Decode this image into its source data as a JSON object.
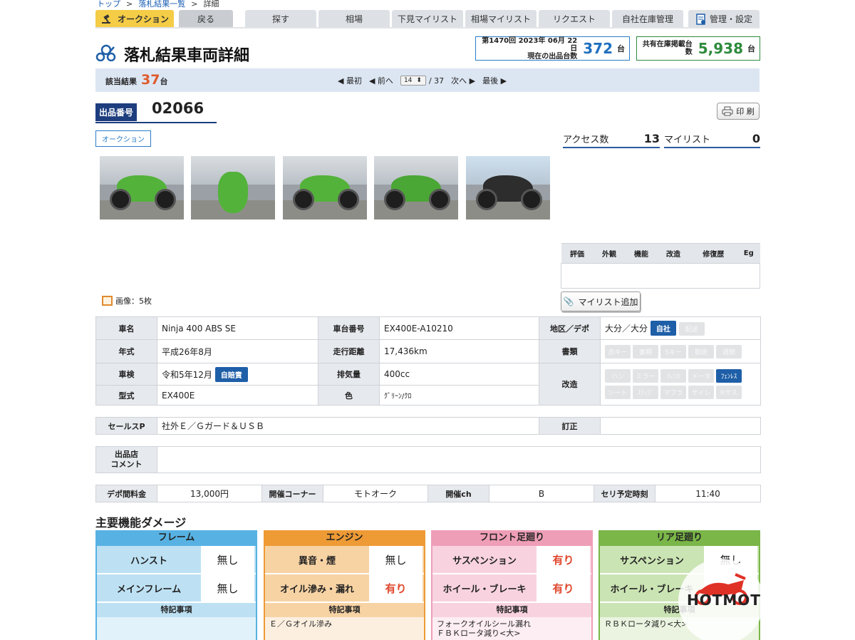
{
  "breadcrumb": [
    "トップ",
    "落札結果一覧",
    "詳細"
  ],
  "breadcrumb_sep": ">",
  "nav": {
    "auction": "オークション",
    "back": "戻る",
    "tabs": [
      "探す",
      "相場",
      "下見マイリスト",
      "相場マイリスト",
      "リクエスト",
      "自社在庫管理"
    ],
    "settings": "管理・設定"
  },
  "page": {
    "title": "落札結果車両詳細",
    "session_line1": "第1470回 2023年 06月 22日",
    "session_line2": "現在の出品台数",
    "listing_count": "372",
    "unit": "台",
    "shared_label": "共有在庫掲載台数",
    "shared_count": "5,938"
  },
  "results": {
    "label": "該当結果",
    "count": "37",
    "unit": "台",
    "first": "◀ 最初",
    "prev": "◀ 前へ",
    "page": "14",
    "total": "/ 37",
    "next": "次へ ▶",
    "last": "最後 ▶"
  },
  "lot": {
    "label": "出品番号",
    "number": "02066",
    "print": "印 刷",
    "tag": "オークション",
    "access_label": "アクセス数",
    "access_value": "13",
    "mylist_label": "マイリスト",
    "mylist_value": "0"
  },
  "photos": [
    "photo-1",
    "photo-2",
    "photo-3",
    "photo-4",
    "photo-5"
  ],
  "image_count": "画像：5枚",
  "eval_headers": [
    "評価",
    "外観",
    "機能",
    "改造",
    "修復歴",
    "Eg"
  ],
  "add_mylist": "マイリスト追加",
  "spec": {
    "name_l": "車名",
    "name": "Ninja 400 ABS SE",
    "frame_l": "車台番号",
    "frame": "EX400E-A10210",
    "area_l": "地区／デポ",
    "area": "大分／大分",
    "area_btn1": "自社",
    "area_btn2": "配送",
    "year_l": "年式",
    "year": "平成26年8月",
    "mileage_l": "走行距離",
    "mileage": "17,436km",
    "docs_l": "書類",
    "docs": [
      "赤キー",
      "書類",
      "Sキー",
      "取説",
      "週間"
    ],
    "inspect_l": "車検",
    "inspect": "令和5年12月",
    "inspect_btn": "自賠責",
    "disp_l": "排気量",
    "disp": "400cc",
    "mod_l": "改造",
    "mods1": [
      "ハン",
      "ミラー",
      "ｳｨﾝｶ",
      "メータ",
      "ﾌｪﾝﾚｽ"
    ],
    "mods2": [
      "シート",
      "ｽﾃｯﾌﾟ",
      "マフラ",
      "サイレ",
      "Rサス"
    ],
    "model_l": "型式",
    "model": "EX400E",
    "color_l": "色",
    "color": "ｸﾞﾘｰﾝ/ｸﾛ",
    "sales_l": "セールスP",
    "sales": "社外Ｅ／Ｇガード＆ＵＳＢ",
    "corr_l": "訂正",
    "corr": "",
    "comment_l1": "出品店",
    "comment_l2": "コメント",
    "comment": "",
    "depo_fee_l": "デポ間料金",
    "depo_fee": "13,000円",
    "corner_l": "開催コーナー",
    "corner": "モトオーク",
    "ch_l": "開催ch",
    "ch": "B",
    "time_l": "セリ予定時刻",
    "time": "11:40"
  },
  "damage": {
    "title": "主要機能ダメージ",
    "notes_label": "特記事項",
    "cards": [
      {
        "title": "フレーム",
        "r1": "ハンスト",
        "v1": "無し",
        "r2": "メインフレーム",
        "v2": "無し",
        "note1": "",
        "note2": ""
      },
      {
        "title": "エンジン",
        "r1": "異音・煙",
        "v1": "無し",
        "r2": "オイル滲み・漏れ",
        "v2": "有り",
        "note1": "Ｅ／Ｇオイル滲み",
        "note2": ""
      },
      {
        "title": "フロント足廻り",
        "r1": "サスペンション",
        "v1": "有り",
        "r2": "ホイール・ブレーキ",
        "v2": "有り",
        "note1": "フォークオイルシール漏れ",
        "note2": "ＦＢＫロータ減り<大>"
      },
      {
        "title": "リア足廻り",
        "r1": "サスペンション",
        "v1": "無し",
        "r2": "ホイール・ブレーキ",
        "v2": "有り",
        "note1": "ＲＢＫロータ減り<大>",
        "note2": ""
      }
    ]
  },
  "logo_text": "HOTMOT",
  "colors": {
    "accent_blue": "#1f5fa8",
    "auction_tab": "#f4cc46",
    "frame_card": "#57b2e3",
    "engine_card": "#ee9a35",
    "front_card": "#ef9eb8",
    "rear_card": "#7ab648",
    "damage_red": "#e0462b"
  }
}
